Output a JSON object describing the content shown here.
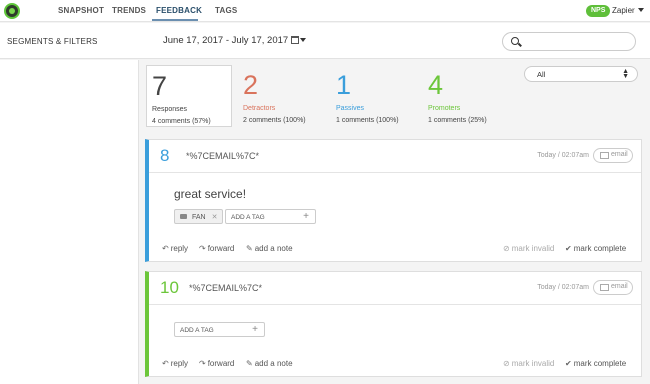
{
  "nav": {
    "items": [
      {
        "label": "SNAPSHOT",
        "active": false
      },
      {
        "label": "TRENDS",
        "active": false
      },
      {
        "label": "FEEDBACK",
        "active": true
      },
      {
        "label": "TAGS",
        "active": false
      }
    ],
    "nps_badge": "NPS",
    "account": "Zapier"
  },
  "subheader": {
    "title": "SEGMENTS & FILTERS",
    "date_range": "June 17, 2017 - July 17, 2017",
    "search_placeholder": ""
  },
  "stats": [
    {
      "value": "7",
      "label": "Responses",
      "sub": "4 comments (57%)",
      "color": "#444444",
      "selected": true
    },
    {
      "value": "2",
      "label": "Detractors",
      "sub": "2 comments (100%)",
      "color": "#d9735c",
      "selected": false
    },
    {
      "value": "1",
      "label": "Passives",
      "sub": "1 comments (100%)",
      "color": "#3a9edb",
      "selected": false
    },
    {
      "value": "4",
      "label": "Promoters",
      "sub": "1 comments (25%)",
      "color": "#6cc63a",
      "selected": false
    }
  ],
  "filter": {
    "selected": "All"
  },
  "responses": [
    {
      "score": "8",
      "score_color": "#3a9edb",
      "email": "*%7CEMAIL%7C*",
      "timestamp": "Today / 02:07am",
      "email_button": "email",
      "comment": "great service!",
      "tags": [
        "FAN"
      ],
      "tag_placeholder": "ADD A TAG"
    },
    {
      "score": "10",
      "score_color": "#6cc63a",
      "email": "*%7CEMAIL%7C*",
      "timestamp": "Today / 02:07am",
      "email_button": "email",
      "comment": "",
      "tags": [],
      "tag_placeholder": "ADD A TAG"
    }
  ],
  "actions": {
    "reply": "reply",
    "forward": "forward",
    "add_note": "add a note",
    "mark_invalid": "mark invalid",
    "mark_complete": "mark complete"
  }
}
